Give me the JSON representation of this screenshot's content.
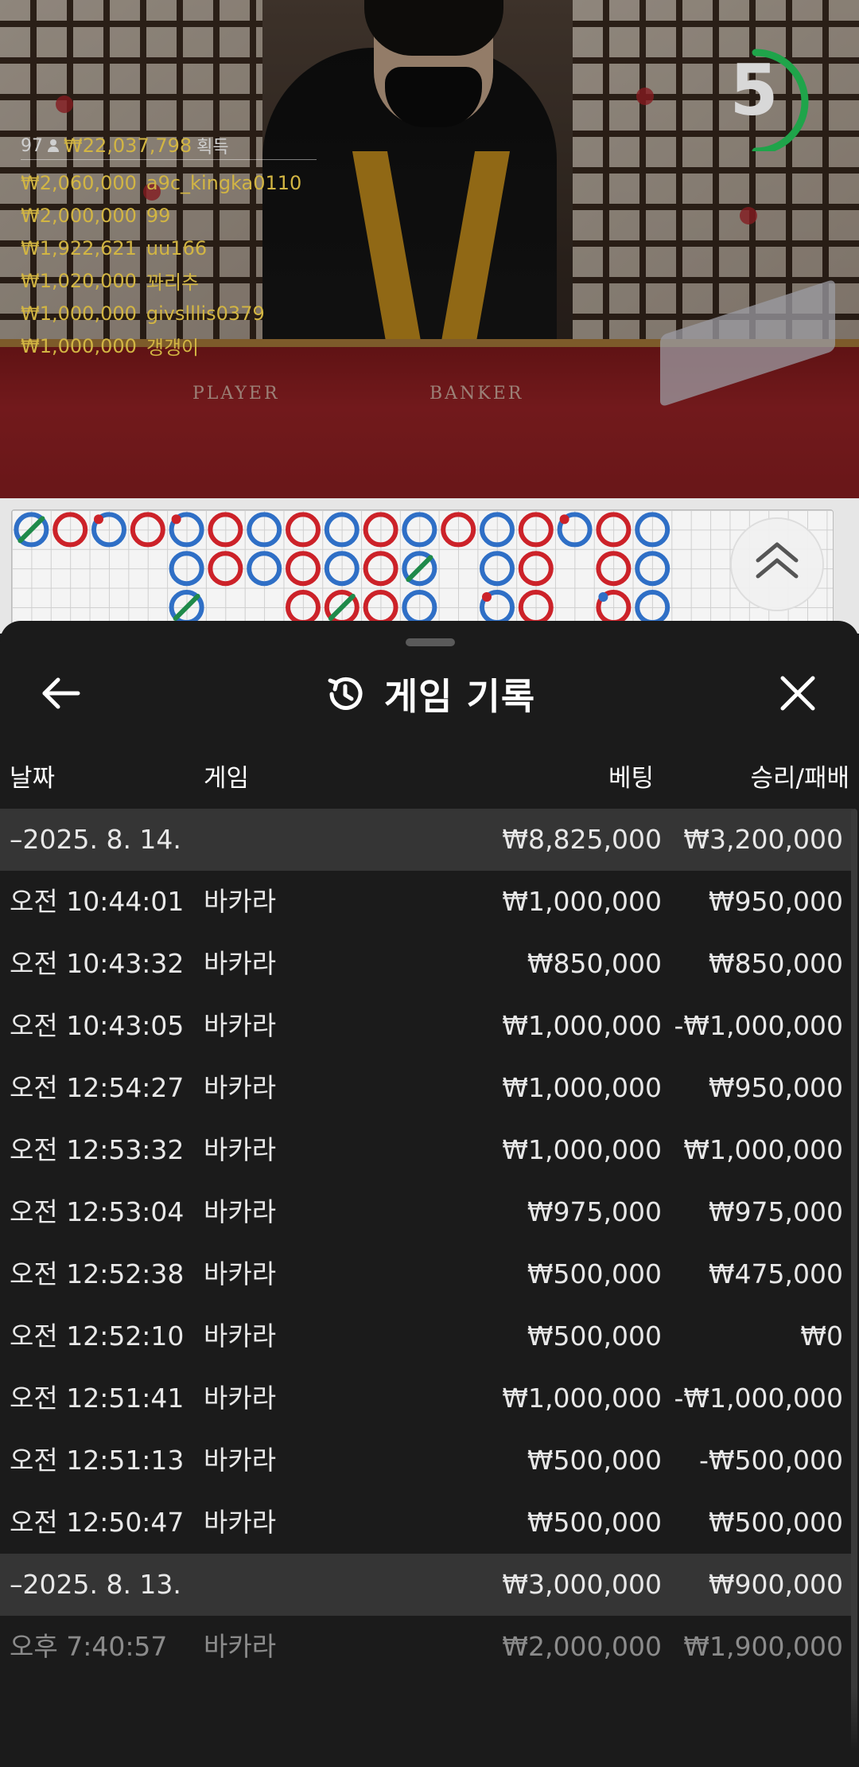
{
  "video": {
    "countdown": "5",
    "countdown_progress": 0.5,
    "table_labels": {
      "player": "PLAYER",
      "banker": "BANKER"
    }
  },
  "winners": {
    "count": "97",
    "total": "₩22,037,798",
    "total_suffix": "획득",
    "items": [
      {
        "amount": "₩2,060,000",
        "name": "a9c_kingka0110"
      },
      {
        "amount": "₩2,000,000",
        "name": "99"
      },
      {
        "amount": "₩1,922,621",
        "name": "uu166"
      },
      {
        "amount": "₩1,020,000",
        "name": "꽈리추"
      },
      {
        "amount": "₩1,000,000",
        "name": "givslllis0379"
      },
      {
        "amount": "₩1,000,000",
        "name": "갱갱이"
      }
    ]
  },
  "roadmap": {
    "colors": {
      "banker": "#cc2229",
      "player": "#2f6fc6",
      "tie": "#1f8a4a"
    },
    "cells": [
      {
        "col": 0,
        "row": 0,
        "s": "P",
        "tie": true
      },
      {
        "col": 1,
        "row": 0,
        "s": "B"
      },
      {
        "col": 2,
        "row": 0,
        "s": "P",
        "pair": true
      },
      {
        "col": 3,
        "row": 0,
        "s": "B"
      },
      {
        "col": 4,
        "row": 0,
        "s": "P",
        "pair": true
      },
      {
        "col": 4,
        "row": 1,
        "s": "P"
      },
      {
        "col": 4,
        "row": 2,
        "s": "P",
        "tie": true
      },
      {
        "col": 5,
        "row": 0,
        "s": "B"
      },
      {
        "col": 5,
        "row": 1,
        "s": "B"
      },
      {
        "col": 6,
        "row": 0,
        "s": "P"
      },
      {
        "col": 6,
        "row": 1,
        "s": "P"
      },
      {
        "col": 7,
        "row": 0,
        "s": "B"
      },
      {
        "col": 7,
        "row": 1,
        "s": "B"
      },
      {
        "col": 7,
        "row": 2,
        "s": "B"
      },
      {
        "col": 8,
        "row": 0,
        "s": "P"
      },
      {
        "col": 8,
        "row": 1,
        "s": "P"
      },
      {
        "col": 8,
        "row": 2,
        "s": "B",
        "tie": true
      },
      {
        "col": 9,
        "row": 0,
        "s": "B"
      },
      {
        "col": 9,
        "row": 1,
        "s": "B"
      },
      {
        "col": 9,
        "row": 2,
        "s": "B"
      },
      {
        "col": 10,
        "row": 0,
        "s": "P"
      },
      {
        "col": 10,
        "row": 1,
        "s": "P",
        "tie": true
      },
      {
        "col": 10,
        "row": 2,
        "s": "P"
      },
      {
        "col": 11,
        "row": 0,
        "s": "B"
      },
      {
        "col": 12,
        "row": 0,
        "s": "P"
      },
      {
        "col": 12,
        "row": 1,
        "s": "P"
      },
      {
        "col": 12,
        "row": 2,
        "s": "P",
        "pair": true
      },
      {
        "col": 13,
        "row": 0,
        "s": "B"
      },
      {
        "col": 13,
        "row": 1,
        "s": "B"
      },
      {
        "col": 13,
        "row": 2,
        "s": "B"
      },
      {
        "col": 14,
        "row": 0,
        "s": "P",
        "pair": true
      },
      {
        "col": 15,
        "row": 0,
        "s": "B"
      },
      {
        "col": 15,
        "row": 1,
        "s": "B"
      },
      {
        "col": 15,
        "row": 2,
        "s": "B",
        "pair": true
      },
      {
        "col": 16,
        "row": 0,
        "s": "P"
      },
      {
        "col": 16,
        "row": 1,
        "s": "P"
      },
      {
        "col": 16,
        "row": 2,
        "s": "P"
      }
    ]
  },
  "sheet": {
    "title": "게임 기록",
    "columns": {
      "date": "날짜",
      "game": "게임",
      "bet": "베팅",
      "result": "승리/패배"
    },
    "groups": [
      {
        "date": "–2025. 8. 14.",
        "bet_total": "₩8,825,000",
        "result_total": "₩3,200,000",
        "rows": [
          {
            "time": "오전 10:44:01",
            "game": "바카라",
            "bet": "₩1,000,000",
            "result": "₩950,000"
          },
          {
            "time": "오전 10:43:32",
            "game": "바카라",
            "bet": "₩850,000",
            "result": "₩850,000"
          },
          {
            "time": "오전 10:43:05",
            "game": "바카라",
            "bet": "₩1,000,000",
            "result": "-₩1,000,000"
          },
          {
            "time": "오전 12:54:27",
            "game": "바카라",
            "bet": "₩1,000,000",
            "result": "₩950,000"
          },
          {
            "time": "오전 12:53:32",
            "game": "바카라",
            "bet": "₩1,000,000",
            "result": "₩1,000,000"
          },
          {
            "time": "오전 12:53:04",
            "game": "바카라",
            "bet": "₩975,000",
            "result": "₩975,000"
          },
          {
            "time": "오전 12:52:38",
            "game": "바카라",
            "bet": "₩500,000",
            "result": "₩475,000"
          },
          {
            "time": "오전 12:52:10",
            "game": "바카라",
            "bet": "₩500,000",
            "result": "₩0"
          },
          {
            "time": "오전 12:51:41",
            "game": "바카라",
            "bet": "₩1,000,000",
            "result": "-₩1,000,000"
          },
          {
            "time": "오전 12:51:13",
            "game": "바카라",
            "bet": "₩500,000",
            "result": "-₩500,000"
          },
          {
            "time": "오전 12:50:47",
            "game": "바카라",
            "bet": "₩500,000",
            "result": "₩500,000"
          }
        ]
      },
      {
        "date": "–2025. 8. 13.",
        "bet_total": "₩3,000,000",
        "result_total": "₩900,000",
        "rows": [
          {
            "time": "오후 7:40:57",
            "game": "바카라",
            "bet": "₩2,000,000",
            "result": "₩1,900,000"
          }
        ]
      }
    ]
  }
}
